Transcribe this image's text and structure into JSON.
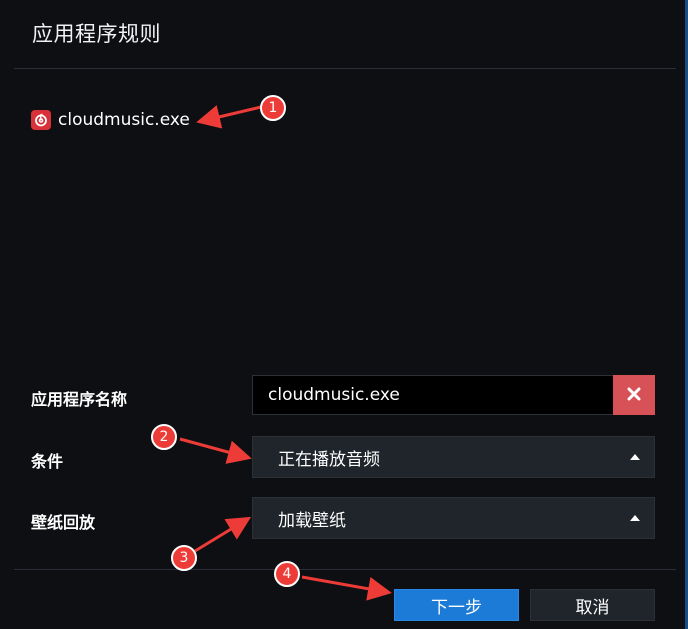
{
  "dialog": {
    "title": "应用程序规则"
  },
  "app_entry": {
    "icon": "netease-cloud-music-icon",
    "name": "cloudmusic.exe"
  },
  "form": {
    "app_name_label": "应用程序名称",
    "app_name_value": "cloudmusic.exe",
    "clear_icon": "close-icon",
    "condition_label": "条件",
    "condition_value": "正在播放音频",
    "wallpaper_label": "壁纸回放",
    "wallpaper_value": "加载壁纸"
  },
  "buttons": {
    "next": "下一步",
    "cancel": "取消"
  },
  "annotations": [
    "1",
    "2",
    "3",
    "4"
  ],
  "colors": {
    "accent": "#1d7bd8",
    "danger": "#d65256",
    "annotation": "#ed3b37"
  }
}
